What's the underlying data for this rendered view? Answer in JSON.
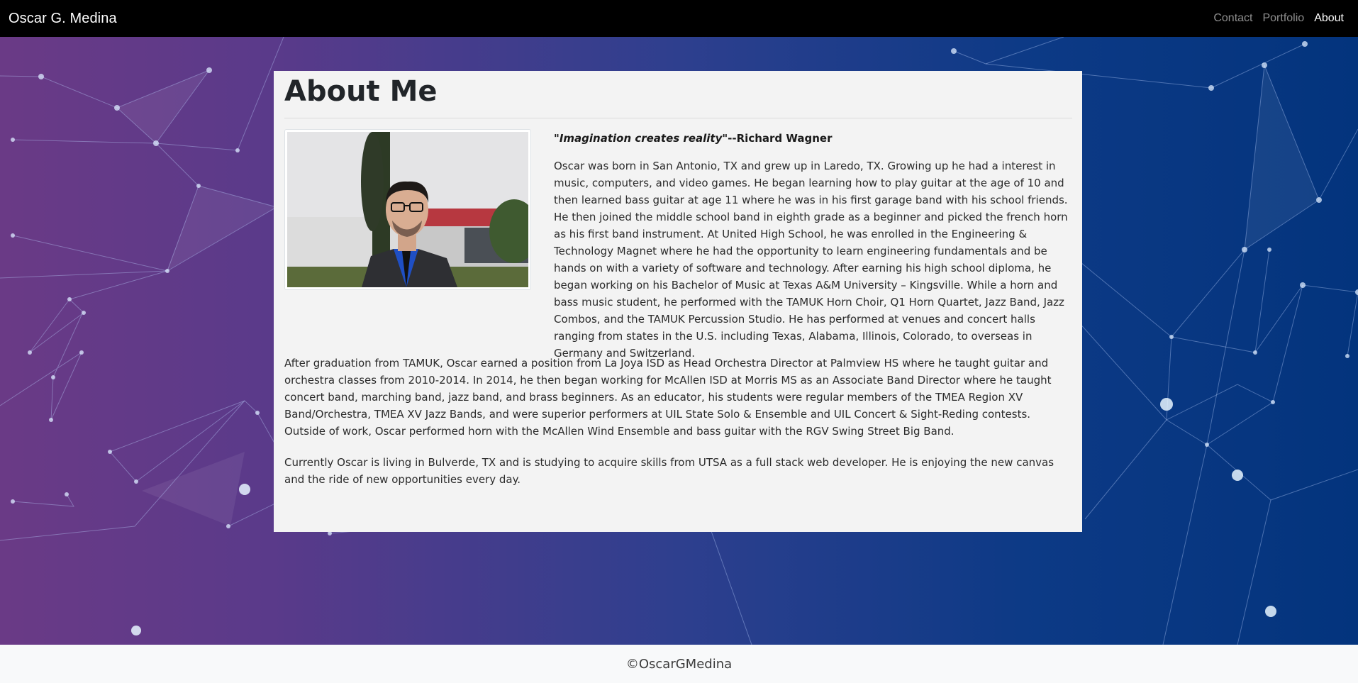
{
  "nav": {
    "brand": "Oscar G. Medina",
    "links": [
      {
        "label": "Contact"
      },
      {
        "label": "Portfolio"
      },
      {
        "label": "About"
      }
    ],
    "active": "About"
  },
  "about": {
    "title": "About Me",
    "photo_alt": "Photo of Oscar G. Medina",
    "quote": "\"Imagination creates reality\"",
    "quote_author": "--Richard Wagner",
    "paragraphs": [
      "Oscar was born in San Antonio, TX and grew up in Laredo, TX. Growing up he had a interest in music, computers, and video games. He began learning how to play guitar at the age of 10 and then learned bass guitar at age 11 where he was in his first garage band with his school friends. He then joined the middle school band in eighth grade as a beginner and picked the french horn as his first band instrument. At United High School, he was enrolled in the Engineering & Technology Magnet where he had the opportunity to learn engineering fundamentals and be hands on with a variety of software and technology. After earning his high school diploma, he began working on his Bachelor of Music at Texas A&M University – Kingsville. While a horn and bass music student, he performed with the TAMUK Horn Choir, Q1 Horn Quartet, Jazz Band, Jazz Combos, and the TAMUK Percussion Studio. He has performed at venues and concert halls ranging from states in the U.S. including Texas, Alabama, Illinois, Colorado, to overseas in Germany and Switzerland.",
      "After graduation from TAMUK, Oscar earned a position from La Joya ISD as Head Orchestra Director at Palmview HS where he taught guitar and orchestra classes from 2010-2014. In 2014, he then began working for McAllen ISD at Morris MS as an Associate Band Director where he taught concert band, marching band, jazz band, and brass beginners. As an educator, his students were regular members of the TMEA Region XV Band/Orchestra, TMEA XV Jazz Bands, and were superior performers at UIL State Solo & Ensemble and UIL Concert & Sight-Reding contests. Outside of work, Oscar performed horn with the McAllen Wind Ensemble and bass guitar with the RGV Swing Street Big Band.",
      "Currently Oscar is living in Bulverde, TX and is studying to acquire skills from UTSA as a full stack web developer. He is enjoying the new canvas and the ride of new opportunities every day."
    ]
  },
  "footer": {
    "copyright": "©OscarGMedina"
  },
  "colors": {
    "navbar": "#000000",
    "panel": "#f3f3f3",
    "gradient_left": "#6a3a86",
    "gradient_right": "#03347d",
    "footer": "#f8f9fa"
  }
}
